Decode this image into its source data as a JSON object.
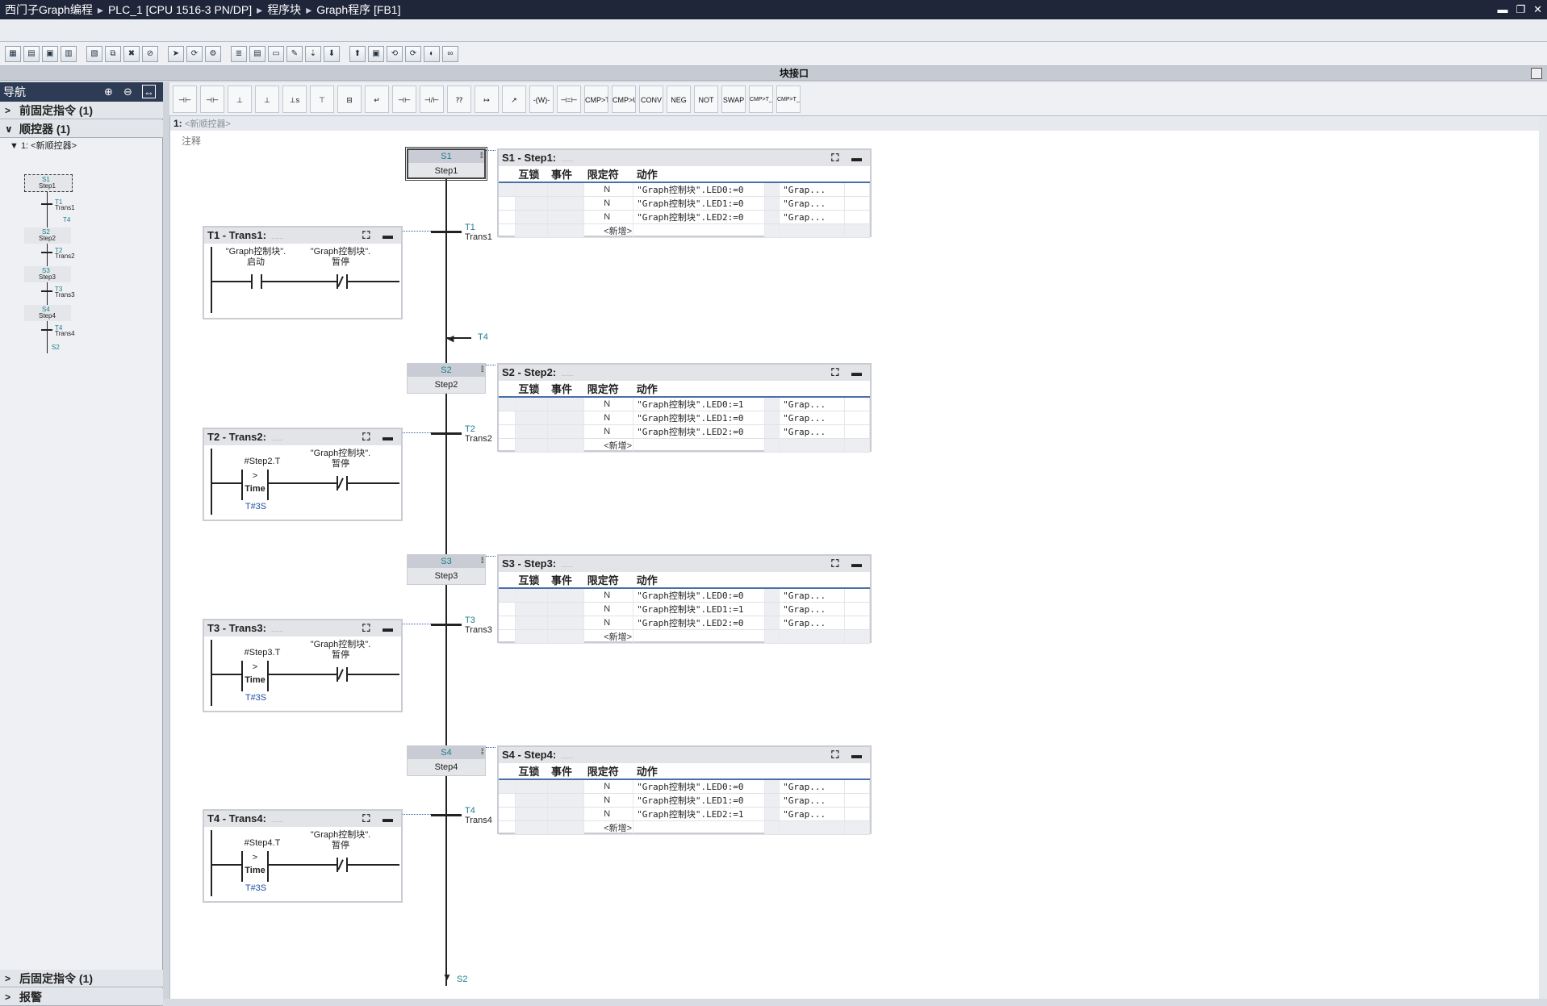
{
  "titlebar": {
    "crumbs": [
      "西门子Graph编程",
      "PLC_1 [CPU 1516-3 PN/DP]",
      "程序块",
      "Graph程序 [FB1]"
    ],
    "sep": "▸",
    "min": "▬",
    "restore": "❐",
    "close": "✕"
  },
  "toolbar1": {
    "icons": [
      "grid-icon",
      "list-icon",
      "sequence-icon",
      "block-icon",
      "monitor-icon",
      "copy-icon",
      "delete-icon",
      "stop-icon",
      "arrow-icon",
      "refresh-icon",
      "compile-icon",
      "list2-icon",
      "table-icon",
      "panel-icon",
      "comment-icon",
      "insert-icon",
      "download-icon",
      "upload-icon",
      "mark-icon",
      "prev-icon",
      "next-icon",
      "view-icon",
      "glasses-icon"
    ]
  },
  "interface_bar": {
    "label": "块接口"
  },
  "nav": {
    "header": "导航",
    "rows": [
      {
        "arrow": ">",
        "label": "前固定指令 (1)"
      },
      {
        "arrow": "∨",
        "label": "顺控器 (1)"
      }
    ],
    "sub": "▼ 1: <新顺控器>",
    "bottom_rows": [
      {
        "arrow": ">",
        "label": "后固定指令 (1)"
      },
      {
        "arrow": ">",
        "label": "报警"
      }
    ],
    "mini": [
      {
        "code": "S1",
        "name": "Step1"
      },
      {
        "code": "T1",
        "name": "Trans1"
      },
      {
        "code": "T4",
        "name": ""
      },
      {
        "code": "S2",
        "name": "Step2"
      },
      {
        "code": "T2",
        "name": "Trans2"
      },
      {
        "code": "S3",
        "name": "Step3"
      },
      {
        "code": "T3",
        "name": "Trans3"
      },
      {
        "code": "S4",
        "name": "Step4"
      },
      {
        "code": "T4",
        "name": "Trans4"
      },
      {
        "code": "S2",
        "name": ""
      }
    ]
  },
  "toolbar2": {
    "items": [
      "⊣⊢",
      "⊣⊢",
      "⊥",
      "⊥",
      "⊥s",
      "⊤",
      "⊟",
      "↵",
      "⊣⊢",
      "⊣/⊢",
      "⁇",
      "↦",
      "↗",
      "-(W)-",
      "⊣=⊢",
      "CMP>T",
      "CMP>U",
      "CONV",
      "NEG",
      "NOT",
      "SWAP",
      "CMP>T_MAX",
      "CMP>T_WARN"
    ]
  },
  "editor": {
    "header_num": "1:",
    "header_name": "<新顺控器>",
    "comment": "注释"
  },
  "cols": {
    "interlock": "互锁",
    "event": "事件",
    "qualifier": "限定符",
    "action": "动作"
  },
  "steps": [
    {
      "code": "S1",
      "name": "Step1",
      "title": "S1 - Step1:",
      "actions": [
        {
          "q": "N",
          "a": "\"Graph控制块\".LED0:=0",
          "r": "\"Grap..."
        },
        {
          "q": "N",
          "a": "\"Graph控制块\".LED1:=0",
          "r": "\"Grap..."
        },
        {
          "q": "N",
          "a": "\"Graph控制块\".LED2:=0",
          "r": "\"Grap..."
        }
      ],
      "add": "<新增>"
    },
    {
      "code": "S2",
      "name": "Step2",
      "title": "S2 - Step2:",
      "actions": [
        {
          "q": "N",
          "a": "\"Graph控制块\".LED0:=1",
          "r": "\"Grap..."
        },
        {
          "q": "N",
          "a": "\"Graph控制块\".LED1:=0",
          "r": "\"Grap..."
        },
        {
          "q": "N",
          "a": "\"Graph控制块\".LED2:=0",
          "r": "\"Grap..."
        }
      ],
      "add": "<新增>"
    },
    {
      "code": "S3",
      "name": "Step3",
      "title": "S3 - Step3:",
      "actions": [
        {
          "q": "N",
          "a": "\"Graph控制块\".LED0:=0",
          "r": "\"Grap..."
        },
        {
          "q": "N",
          "a": "\"Graph控制块\".LED1:=1",
          "r": "\"Grap..."
        },
        {
          "q": "N",
          "a": "\"Graph控制块\".LED2:=0",
          "r": "\"Grap..."
        }
      ],
      "add": "<新增>"
    },
    {
      "code": "S4",
      "name": "Step4",
      "title": "S4 - Step4:",
      "actions": [
        {
          "q": "N",
          "a": "\"Graph控制块\".LED0:=0",
          "r": "\"Grap..."
        },
        {
          "q": "N",
          "a": "\"Graph控制块\".LED1:=0",
          "r": "\"Grap..."
        },
        {
          "q": "N",
          "a": "\"Graph控制块\".LED2:=1",
          "r": "\"Grap..."
        }
      ],
      "add": "<新增>"
    }
  ],
  "transitions": [
    {
      "code": "T1",
      "name": "Trans1",
      "title": "T1 - Trans1:",
      "left_label": "\"Graph控制块\".",
      "left_label2": "启动",
      "right_label": "\"Graph控制块\".",
      "right_label2": "暂停",
      "cmp_var": "",
      "cmp_op": "",
      "cmp_type": "",
      "cmp_val": ""
    },
    {
      "code": "T2",
      "name": "Trans2",
      "title": "T2 - Trans2:",
      "left_label": "",
      "left_label2": "",
      "right_label": "\"Graph控制块\".",
      "right_label2": "暂停",
      "cmp_var": "#Step2.T",
      "cmp_op": ">",
      "cmp_type": "Time",
      "cmp_val": "T#3S"
    },
    {
      "code": "T3",
      "name": "Trans3",
      "title": "T3 - Trans3:",
      "left_label": "",
      "left_label2": "",
      "right_label": "\"Graph控制块\".",
      "right_label2": "暂停",
      "cmp_var": "#Step3.T",
      "cmp_op": ">",
      "cmp_type": "Time",
      "cmp_val": "T#3S"
    },
    {
      "code": "T4",
      "name": "Trans4",
      "title": "T4 - Trans4:",
      "left_label": "",
      "left_label2": "",
      "right_label": "\"Graph控制块\".",
      "right_label2": "暂停",
      "cmp_var": "#Step4.T",
      "cmp_op": ">",
      "cmp_type": "Time",
      "cmp_val": "T#3S"
    }
  ],
  "jump_in": "T4",
  "jump_out": "S2",
  "panel_ctl": "⛶ ▬"
}
